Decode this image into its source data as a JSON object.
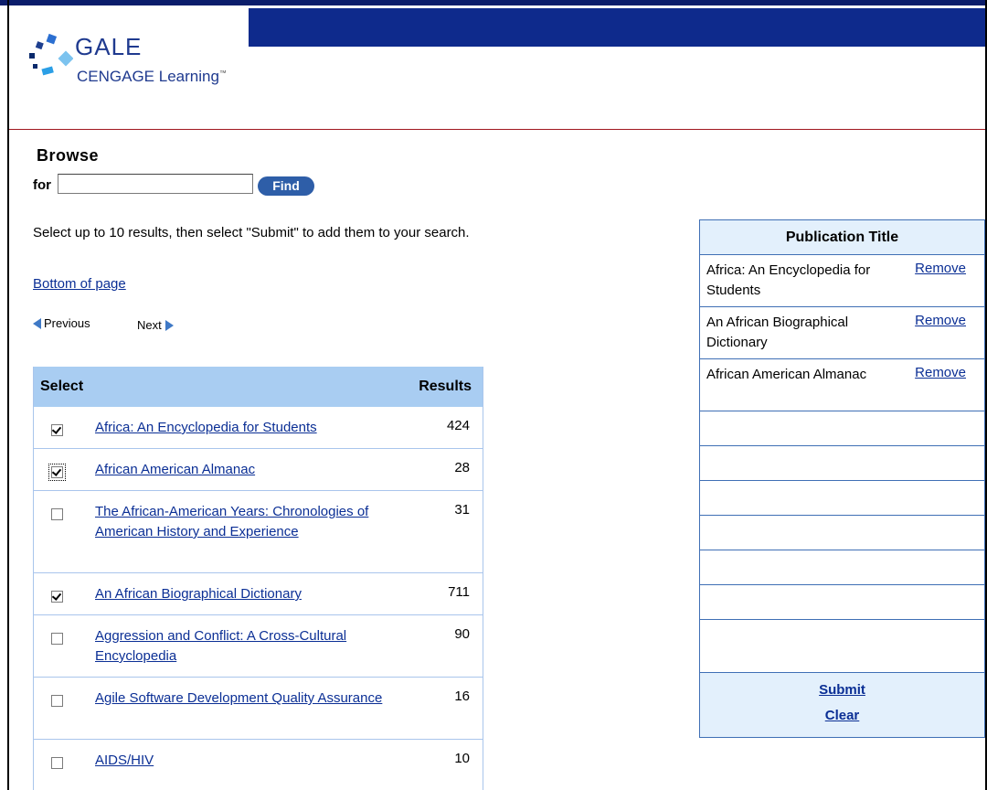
{
  "logo": {
    "brand": "GALE",
    "sub": "CENGAGE Learning",
    "tm": "™"
  },
  "browse": {
    "title": "Browse",
    "for_label": "for",
    "input_value": "",
    "find_label": "Find"
  },
  "instructions": "Select up to 10 results, then select \"Submit\" to add them to your search.",
  "nav": {
    "bottom_of_page": "Bottom of page",
    "previous": "Previous",
    "next": "Next"
  },
  "results": {
    "col_select": "Select",
    "col_results": "Results",
    "rows": [
      {
        "title": "Africa: An Encyclopedia for Students",
        "count": "424",
        "checked": true
      },
      {
        "title": "African American Almanac",
        "count": "28",
        "checked": true
      },
      {
        "title": "The African-American Years: Chronologies of American History and Experience",
        "count": "31",
        "checked": false
      },
      {
        "title": "An African Biographical Dictionary",
        "count": "711",
        "checked": true
      },
      {
        "title": "Aggression and Conflict: A Cross-Cultural Encyclopedia",
        "count": "90",
        "checked": false
      },
      {
        "title": "Agile Software Development Quality Assurance",
        "count": "16",
        "checked": false
      },
      {
        "title": "AIDS/HIV",
        "count": "10",
        "checked": false
      }
    ]
  },
  "publication": {
    "header": "Publication Title",
    "remove_label": "Remove",
    "items": [
      {
        "name": "Africa: An Encyclopedia for Students"
      },
      {
        "name": "An African Biographical Dictionary"
      },
      {
        "name": "African American Almanac"
      }
    ],
    "submit_label": "Submit",
    "clear_label": "Clear"
  },
  "colors": {
    "banner": "#0e2a8c",
    "table_header": "#a9cdf2",
    "link": "#0b2f95",
    "rule": "#a0171f"
  }
}
